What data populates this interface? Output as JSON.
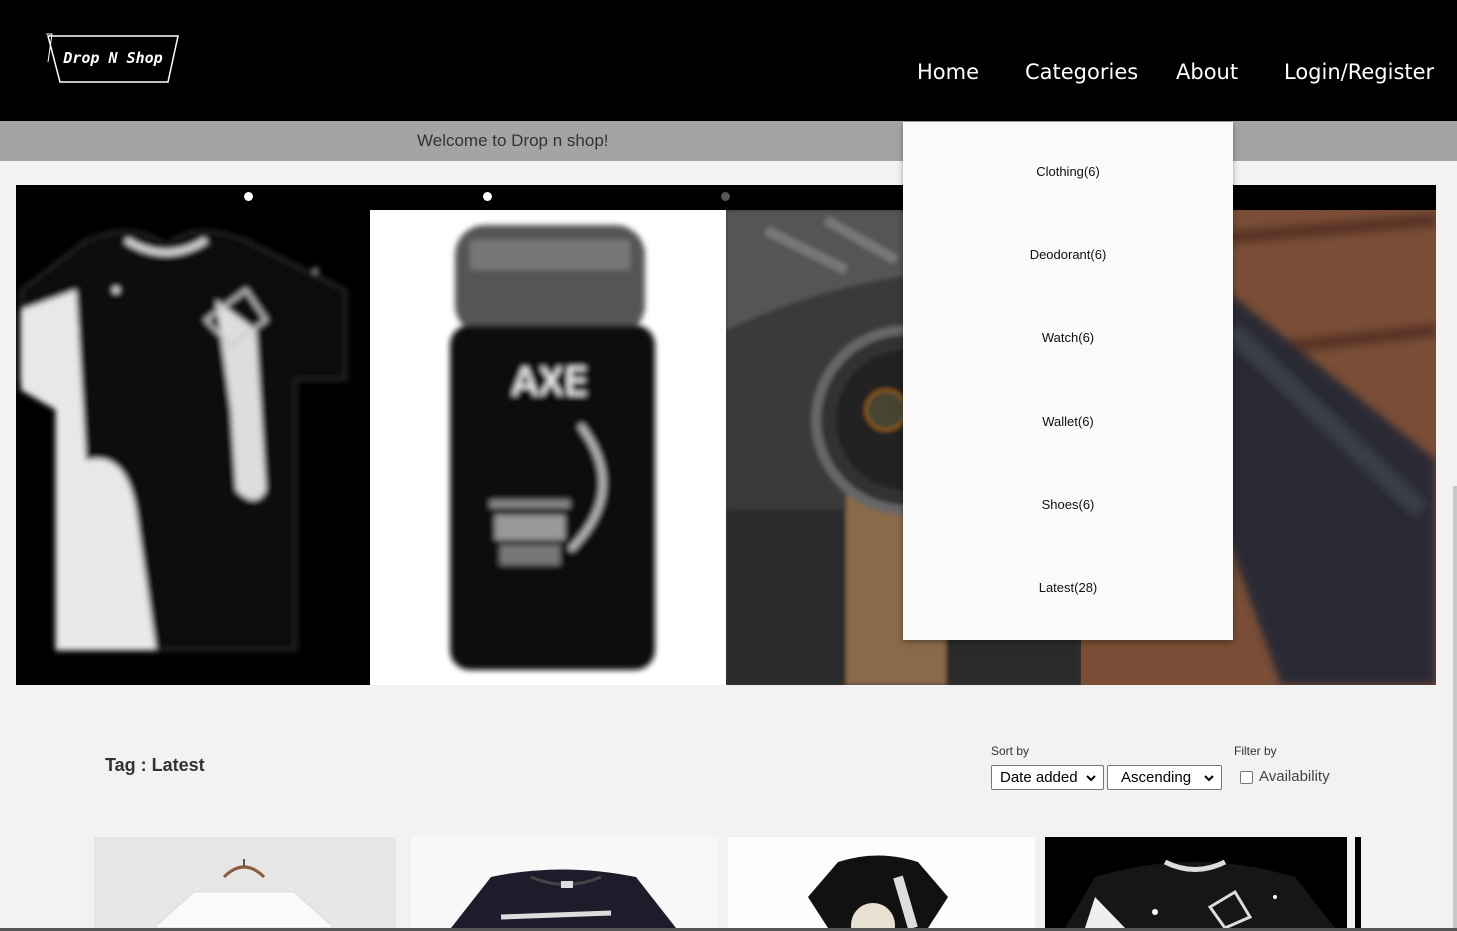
{
  "brand": {
    "logo_text": "Drop N Shop"
  },
  "nav": {
    "home": "Home",
    "categories": "Categories",
    "about": "About",
    "login": "Login/Register"
  },
  "welcome_text": "Welcome to Drop n shop!",
  "categories_menu": [
    {
      "label": "Clothing(6)"
    },
    {
      "label": "Deodorant(6)"
    },
    {
      "label": "Watch(6)"
    },
    {
      "label": "Wallet(6)"
    },
    {
      "label": "Shoes(6)"
    },
    {
      "label": "Latest(28)"
    }
  ],
  "slider": {
    "slides": [
      "t-shirt",
      "deodorant",
      "watch",
      "wallet"
    ],
    "active_dot": 1
  },
  "listing": {
    "tag_title": "Tag : Latest",
    "sort_label": "Sort by",
    "sort_value": "Date added",
    "order_value": "Ascending",
    "filter_label": "Filter by",
    "availability_label": "Availability",
    "availability_checked": false
  },
  "colors": {
    "topbar": "#000000",
    "welcome_bar": "#a4a4a4",
    "page_bg": "#f2f2f2"
  }
}
